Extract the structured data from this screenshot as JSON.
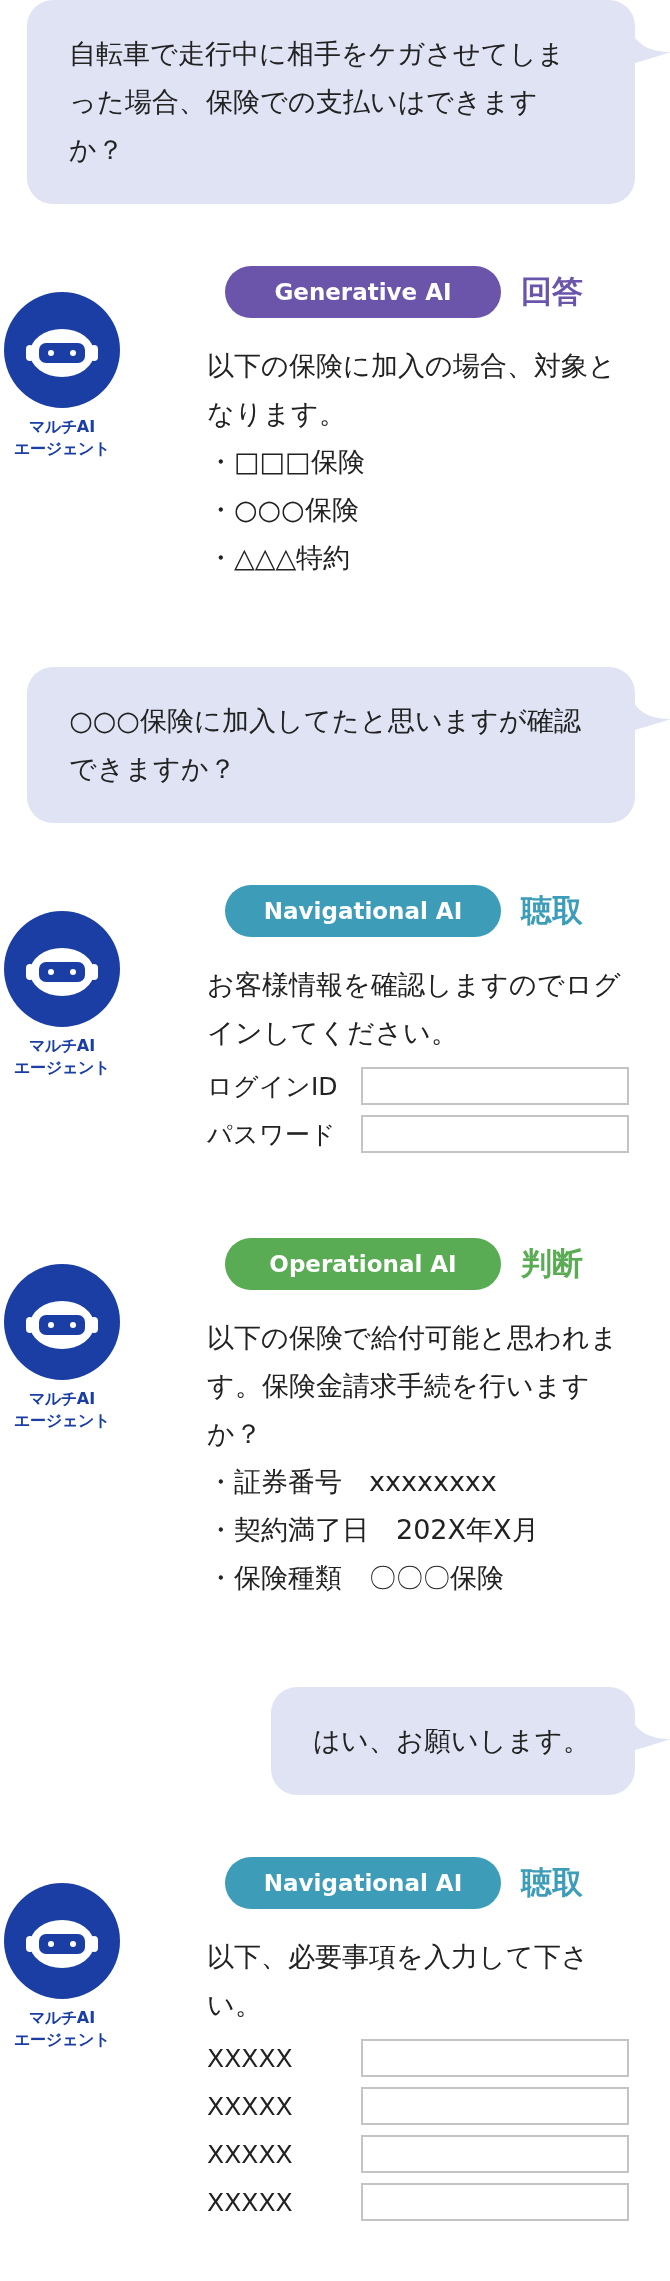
{
  "messages": [
    {
      "kind": "user",
      "text": "自転車で走行中に相手をケガさせてしまった場合、保険での支払いはできますか？"
    },
    {
      "kind": "agent",
      "badge": {
        "label": "Generative AI",
        "color": "#6b55ab"
      },
      "mode": "回答",
      "agent_name": "マルチAI\nエージェント",
      "items": [
        {
          "kind": "text",
          "text": "以下の保険に加入の場合、対象となります。"
        },
        {
          "kind": "bullet",
          "text": "・□□□保険"
        },
        {
          "kind": "bullet",
          "text": "・○○○保険"
        },
        {
          "kind": "bullet",
          "text": "・△△△特約"
        }
      ]
    },
    {
      "kind": "user",
      "text": "○○○保険に加入してたと思いますが確認できますか？"
    },
    {
      "kind": "agent",
      "badge": {
        "label": "Navigational AI",
        "color": "#3d9db9"
      },
      "mode": "聴取",
      "agent_name": "マルチAI\nエージェント",
      "items": [
        {
          "kind": "text",
          "text": "お客様情報を確認しますのでログインしてください。"
        },
        {
          "kind": "field",
          "label": "ログインID"
        },
        {
          "kind": "field",
          "label": "パスワード"
        }
      ]
    },
    {
      "kind": "agent",
      "badge": {
        "label": "Operational AI",
        "color": "#5aac54"
      },
      "mode": "判断",
      "agent_name": "マルチAI\nエージェント",
      "items": [
        {
          "kind": "text",
          "text": "以下の保険で給付可能と思われます。保険金請求手続を行いますか？"
        },
        {
          "kind": "bullet",
          "text": "・証券番号　xxxxxxxx"
        },
        {
          "kind": "bullet",
          "text": "・契約満了日　202X年X月"
        },
        {
          "kind": "bullet",
          "text": "・保険種類　〇〇〇保険"
        }
      ]
    },
    {
      "kind": "user",
      "text": "はい、お願いします。"
    },
    {
      "kind": "agent",
      "badge": {
        "label": "Navigational AI",
        "color": "#3d9db9"
      },
      "mode": "聴取",
      "agent_name": "マルチAI\nエージェント",
      "items": [
        {
          "kind": "text",
          "text": "以下、必要事項を入力して下さい。"
        },
        {
          "kind": "field",
          "label": "XXXXX"
        },
        {
          "kind": "field",
          "label": "XXXXX"
        },
        {
          "kind": "field",
          "label": "XXXXX"
        },
        {
          "kind": "field",
          "label": "XXXXX"
        }
      ]
    }
  ]
}
